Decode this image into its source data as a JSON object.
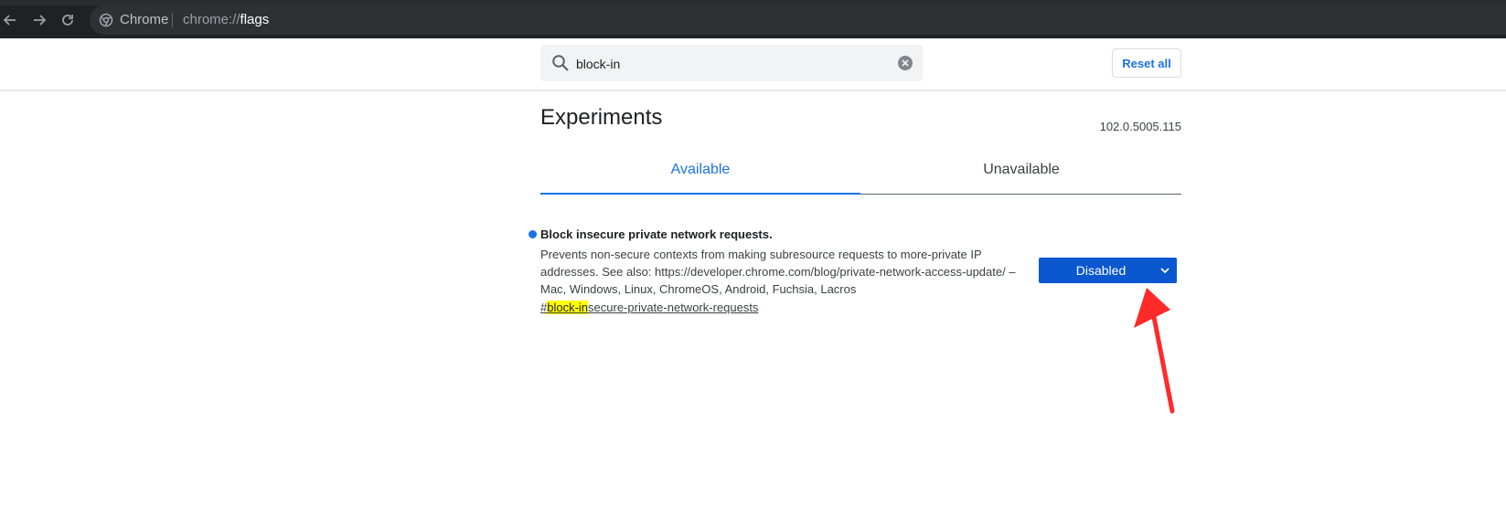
{
  "browser": {
    "site_label": "Chrome",
    "url_scheme": "chrome://",
    "url_host": "flags"
  },
  "search": {
    "value": "block-in"
  },
  "header": {
    "reset_label": "Reset all"
  },
  "main": {
    "title": "Experiments",
    "version": "102.0.5005.115",
    "tabs": [
      {
        "label": "Available",
        "active": true
      },
      {
        "label": "Unavailable",
        "active": false
      }
    ]
  },
  "experiment": {
    "title": "Block insecure private network requests.",
    "description": "Prevents non-secure contexts from making subresource requests to more-private IP addresses. See also: https://developer.chrome.com/blog/private-network-access-update/ – Mac, Windows, Linux, ChromeOS, Android, Fuchsia, Lacros",
    "link_prefix": "#",
    "link_highlight": "block-in",
    "link_rest": "secure-private-network-requests",
    "selected_option": "Disabled"
  },
  "colors": {
    "accent": "#1a73e8",
    "select_bg": "#0b57d0",
    "highlight": "#ffff00",
    "annotation_arrow": "#ff2a2a"
  }
}
